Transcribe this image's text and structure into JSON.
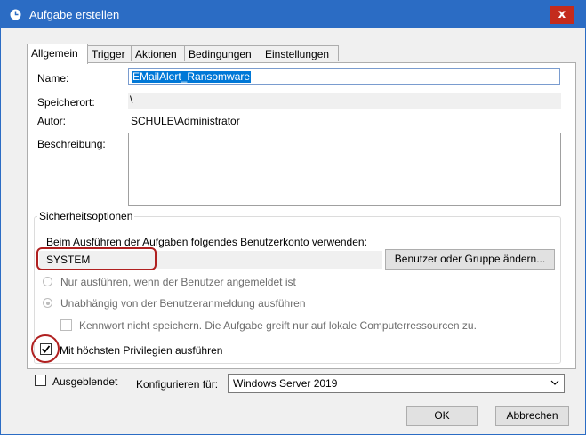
{
  "window": {
    "title": "Aufgabe erstellen",
    "close_label": "x"
  },
  "tabs": [
    {
      "label": "Allgemein"
    },
    {
      "label": "Trigger"
    },
    {
      "label": "Aktionen"
    },
    {
      "label": "Bedingungen"
    },
    {
      "label": "Einstellungen"
    }
  ],
  "general": {
    "name_label": "Name:",
    "name_value": "EMailAlert_Ransomware",
    "location_label": "Speicherort:",
    "location_value": "\\",
    "author_label": "Autor:",
    "author_value": "SCHULE\\Administrator",
    "description_label": "Beschreibung:",
    "description_value": ""
  },
  "security": {
    "group_title": "Sicherheitsoptionen",
    "account_prompt": "Beim Ausführen der Aufgaben folgendes Benutzerkonto verwenden:",
    "account_value": "SYSTEM",
    "change_button": "Benutzer oder Gruppe ändern...",
    "radio_logged_on": "Nur ausführen, wenn der Benutzer angemeldet ist",
    "radio_regardless": "Unabhängig von der Benutzeranmeldung ausführen",
    "no_store_password": "Kennwort nicht speichern. Die Aufgabe greift nur auf lokale Computerressourcen zu.",
    "highest_privileges": "Mit höchsten Privilegien ausführen",
    "highest_privileges_checked": true
  },
  "footer": {
    "hidden_label": "Ausgeblendet",
    "configure_label": "Konfigurieren für:",
    "configure_value": "Windows Server 2019",
    "ok_button": "OK",
    "cancel_button": "Abbrechen"
  },
  "colors": {
    "titlebar": "#2b6cc4",
    "close": "#c42b1c",
    "highlight": "#b02020",
    "selection": "#0078d7"
  }
}
